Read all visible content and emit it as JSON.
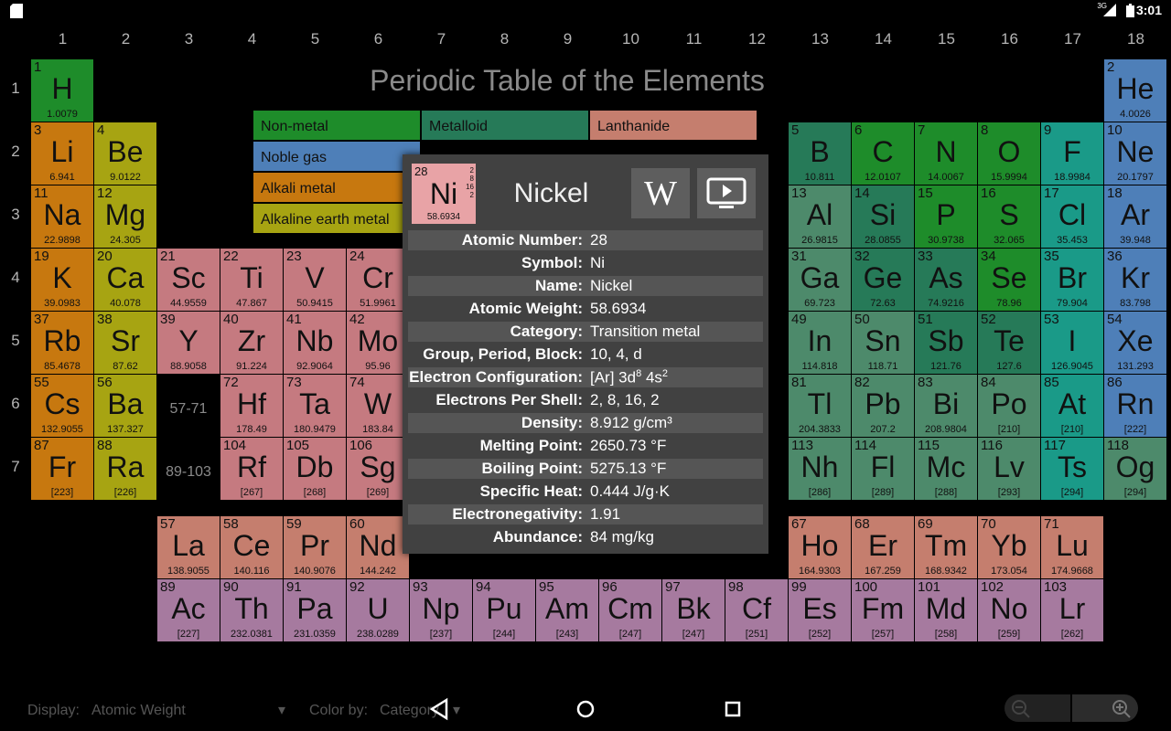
{
  "status_bar": {
    "time": "3:01",
    "signal_label": "3G"
  },
  "title": "Periodic Table of the Elements",
  "group_numbers": [
    "1",
    "2",
    "3",
    "4",
    "5",
    "6",
    "7",
    "8",
    "9",
    "10",
    "11",
    "12",
    "13",
    "14",
    "15",
    "16",
    "17",
    "18"
  ],
  "period_numbers": [
    "1",
    "2",
    "3",
    "4",
    "5",
    "6",
    "7"
  ],
  "colors": {
    "nonmetal": "#1e8c2a",
    "noble_gas": "#4e7fb8",
    "alkali": "#c7780f",
    "alkaline": "#a7a412",
    "metalloid": "#267a58",
    "lanthanide": "#c57e6e",
    "actinide": "#a67a9f",
    "transition": "#c57a80",
    "post_transition": "#4d8a6b",
    "halogen": "#1a9a88",
    "unknown": "#4d8a6b",
    "popup_bg": "#414141",
    "nickel_cell": "#e8a3a6"
  },
  "legend": [
    {
      "label": "Non-metal",
      "color_key": "nonmetal"
    },
    {
      "label": "Metalloid",
      "color_key": "metalloid"
    },
    {
      "label": "Lanthanide",
      "color_key": "lanthanide"
    },
    {
      "label": "Noble gas",
      "color_key": "noble_gas"
    },
    {
      "label": "Alkali metal",
      "color_key": "alkali"
    },
    {
      "label": "Alkaline earth metal",
      "color_key": "alkaline"
    }
  ],
  "range_labels": [
    "57-71",
    "89-103"
  ],
  "elements": [
    {
      "n": "1",
      "s": "H",
      "w": "1.0079",
      "c": "nonmetal",
      "col": 1,
      "row": 1
    },
    {
      "n": "2",
      "s": "He",
      "w": "4.0026",
      "c": "noble_gas",
      "col": 18,
      "row": 1
    },
    {
      "n": "3",
      "s": "Li",
      "w": "6.941",
      "c": "alkali",
      "col": 1,
      "row": 2
    },
    {
      "n": "4",
      "s": "Be",
      "w": "9.0122",
      "c": "alkaline",
      "col": 2,
      "row": 2
    },
    {
      "n": "5",
      "s": "B",
      "w": "10.811",
      "c": "metalloid",
      "col": 13,
      "row": 2
    },
    {
      "n": "6",
      "s": "C",
      "w": "12.0107",
      "c": "nonmetal",
      "col": 14,
      "row": 2
    },
    {
      "n": "7",
      "s": "N",
      "w": "14.0067",
      "c": "nonmetal",
      "col": 15,
      "row": 2
    },
    {
      "n": "8",
      "s": "O",
      "w": "15.9994",
      "c": "nonmetal",
      "col": 16,
      "row": 2
    },
    {
      "n": "9",
      "s": "F",
      "w": "18.9984",
      "c": "halogen",
      "col": 17,
      "row": 2
    },
    {
      "n": "10",
      "s": "Ne",
      "w": "20.1797",
      "c": "noble_gas",
      "col": 18,
      "row": 2
    },
    {
      "n": "11",
      "s": "Na",
      "w": "22.9898",
      "c": "alkali",
      "col": 1,
      "row": 3
    },
    {
      "n": "12",
      "s": "Mg",
      "w": "24.305",
      "c": "alkaline",
      "col": 2,
      "row": 3
    },
    {
      "n": "13",
      "s": "Al",
      "w": "26.9815",
      "c": "post_transition",
      "col": 13,
      "row": 3
    },
    {
      "n": "14",
      "s": "Si",
      "w": "28.0855",
      "c": "metalloid",
      "col": 14,
      "row": 3
    },
    {
      "n": "15",
      "s": "P",
      "w": "30.9738",
      "c": "nonmetal",
      "col": 15,
      "row": 3
    },
    {
      "n": "16",
      "s": "S",
      "w": "32.065",
      "c": "nonmetal",
      "col": 16,
      "row": 3
    },
    {
      "n": "17",
      "s": "Cl",
      "w": "35.453",
      "c": "halogen",
      "col": 17,
      "row": 3
    },
    {
      "n": "18",
      "s": "Ar",
      "w": "39.948",
      "c": "noble_gas",
      "col": 18,
      "row": 3
    },
    {
      "n": "19",
      "s": "K",
      "w": "39.0983",
      "c": "alkali",
      "col": 1,
      "row": 4
    },
    {
      "n": "20",
      "s": "Ca",
      "w": "40.078",
      "c": "alkaline",
      "col": 2,
      "row": 4
    },
    {
      "n": "21",
      "s": "Sc",
      "w": "44.9559",
      "c": "transition",
      "col": 3,
      "row": 4
    },
    {
      "n": "22",
      "s": "Ti",
      "w": "47.867",
      "c": "transition",
      "col": 4,
      "row": 4
    },
    {
      "n": "23",
      "s": "V",
      "w": "50.9415",
      "c": "transition",
      "col": 5,
      "row": 4
    },
    {
      "n": "24",
      "s": "Cr",
      "w": "51.9961",
      "c": "transition",
      "col": 6,
      "row": 4
    },
    {
      "n": "31",
      "s": "Ga",
      "w": "69.723",
      "c": "post_transition",
      "col": 13,
      "row": 4
    },
    {
      "n": "32",
      "s": "Ge",
      "w": "72.63",
      "c": "metalloid",
      "col": 14,
      "row": 4
    },
    {
      "n": "33",
      "s": "As",
      "w": "74.9216",
      "c": "metalloid",
      "col": 15,
      "row": 4
    },
    {
      "n": "34",
      "s": "Se",
      "w": "78.96",
      "c": "nonmetal",
      "col": 16,
      "row": 4
    },
    {
      "n": "35",
      "s": "Br",
      "w": "79.904",
      "c": "halogen",
      "col": 17,
      "row": 4
    },
    {
      "n": "36",
      "s": "Kr",
      "w": "83.798",
      "c": "noble_gas",
      "col": 18,
      "row": 4
    },
    {
      "n": "37",
      "s": "Rb",
      "w": "85.4678",
      "c": "alkali",
      "col": 1,
      "row": 5
    },
    {
      "n": "38",
      "s": "Sr",
      "w": "87.62",
      "c": "alkaline",
      "col": 2,
      "row": 5
    },
    {
      "n": "39",
      "s": "Y",
      "w": "88.9058",
      "c": "transition",
      "col": 3,
      "row": 5
    },
    {
      "n": "40",
      "s": "Zr",
      "w": "91.224",
      "c": "transition",
      "col": 4,
      "row": 5
    },
    {
      "n": "41",
      "s": "Nb",
      "w": "92.9064",
      "c": "transition",
      "col": 5,
      "row": 5
    },
    {
      "n": "42",
      "s": "Mo",
      "w": "95.96",
      "c": "transition",
      "col": 6,
      "row": 5
    },
    {
      "n": "49",
      "s": "In",
      "w": "114.818",
      "c": "post_transition",
      "col": 13,
      "row": 5
    },
    {
      "n": "50",
      "s": "Sn",
      "w": "118.71",
      "c": "post_transition",
      "col": 14,
      "row": 5
    },
    {
      "n": "51",
      "s": "Sb",
      "w": "121.76",
      "c": "metalloid",
      "col": 15,
      "row": 5
    },
    {
      "n": "52",
      "s": "Te",
      "w": "127.6",
      "c": "metalloid",
      "col": 16,
      "row": 5
    },
    {
      "n": "53",
      "s": "I",
      "w": "126.9045",
      "c": "halogen",
      "col": 17,
      "row": 5
    },
    {
      "n": "54",
      "s": "Xe",
      "w": "131.293",
      "c": "noble_gas",
      "col": 18,
      "row": 5
    },
    {
      "n": "55",
      "s": "Cs",
      "w": "132.9055",
      "c": "alkali",
      "col": 1,
      "row": 6
    },
    {
      "n": "56",
      "s": "Ba",
      "w": "137.327",
      "c": "alkaline",
      "col": 2,
      "row": 6
    },
    {
      "n": "72",
      "s": "Hf",
      "w": "178.49",
      "c": "transition",
      "col": 4,
      "row": 6
    },
    {
      "n": "73",
      "s": "Ta",
      "w": "180.9479",
      "c": "transition",
      "col": 5,
      "row": 6
    },
    {
      "n": "74",
      "s": "W",
      "w": "183.84",
      "c": "transition",
      "col": 6,
      "row": 6
    },
    {
      "n": "81",
      "s": "Tl",
      "w": "204.3833",
      "c": "post_transition",
      "col": 13,
      "row": 6
    },
    {
      "n": "82",
      "s": "Pb",
      "w": "207.2",
      "c": "post_transition",
      "col": 14,
      "row": 6
    },
    {
      "n": "83",
      "s": "Bi",
      "w": "208.9804",
      "c": "post_transition",
      "col": 15,
      "row": 6
    },
    {
      "n": "84",
      "s": "Po",
      "w": "[210]",
      "c": "post_transition",
      "col": 16,
      "row": 6
    },
    {
      "n": "85",
      "s": "At",
      "w": "[210]",
      "c": "halogen",
      "col": 17,
      "row": 6
    },
    {
      "n": "86",
      "s": "Rn",
      "w": "[222]",
      "c": "noble_gas",
      "col": 18,
      "row": 6
    },
    {
      "n": "87",
      "s": "Fr",
      "w": "[223]",
      "c": "alkali",
      "col": 1,
      "row": 7
    },
    {
      "n": "88",
      "s": "Ra",
      "w": "[226]",
      "c": "alkaline",
      "col": 2,
      "row": 7
    },
    {
      "n": "104",
      "s": "Rf",
      "w": "[267]",
      "c": "transition",
      "col": 4,
      "row": 7
    },
    {
      "n": "105",
      "s": "Db",
      "w": "[268]",
      "c": "transition",
      "col": 5,
      "row": 7
    },
    {
      "n": "106",
      "s": "Sg",
      "w": "[269]",
      "c": "transition",
      "col": 6,
      "row": 7
    },
    {
      "n": "113",
      "s": "Nh",
      "w": "[286]",
      "c": "unknown",
      "col": 13,
      "row": 7
    },
    {
      "n": "114",
      "s": "Fl",
      "w": "[289]",
      "c": "unknown",
      "col": 14,
      "row": 7
    },
    {
      "n": "115",
      "s": "Mc",
      "w": "[288]",
      "c": "unknown",
      "col": 15,
      "row": 7
    },
    {
      "n": "116",
      "s": "Lv",
      "w": "[293]",
      "c": "unknown",
      "col": 16,
      "row": 7
    },
    {
      "n": "117",
      "s": "Ts",
      "w": "[294]",
      "c": "halogen",
      "col": 17,
      "row": 7
    },
    {
      "n": "118",
      "s": "Og",
      "w": "[294]",
      "c": "unknown",
      "col": 18,
      "row": 7
    },
    {
      "n": "57",
      "s": "La",
      "w": "138.9055",
      "c": "lanthanide",
      "col": 3,
      "row": 8
    },
    {
      "n": "58",
      "s": "Ce",
      "w": "140.116",
      "c": "lanthanide",
      "col": 4,
      "row": 8
    },
    {
      "n": "59",
      "s": "Pr",
      "w": "140.9076",
      "c": "lanthanide",
      "col": 5,
      "row": 8
    },
    {
      "n": "60",
      "s": "Nd",
      "w": "144.242",
      "c": "lanthanide",
      "col": 6,
      "row": 8
    },
    {
      "n": "67",
      "s": "Ho",
      "w": "164.9303",
      "c": "lanthanide",
      "col": 13,
      "row": 8
    },
    {
      "n": "68",
      "s": "Er",
      "w": "167.259",
      "c": "lanthanide",
      "col": 14,
      "row": 8
    },
    {
      "n": "69",
      "s": "Tm",
      "w": "168.9342",
      "c": "lanthanide",
      "col": 15,
      "row": 8
    },
    {
      "n": "70",
      "s": "Yb",
      "w": "173.054",
      "c": "lanthanide",
      "col": 16,
      "row": 8
    },
    {
      "n": "71",
      "s": "Lu",
      "w": "174.9668",
      "c": "lanthanide",
      "col": 17,
      "row": 8
    },
    {
      "n": "89",
      "s": "Ac",
      "w": "[227]",
      "c": "actinide",
      "col": 3,
      "row": 9
    },
    {
      "n": "90",
      "s": "Th",
      "w": "232.0381",
      "c": "actinide",
      "col": 4,
      "row": 9
    },
    {
      "n": "91",
      "s": "Pa",
      "w": "231.0359",
      "c": "actinide",
      "col": 5,
      "row": 9
    },
    {
      "n": "92",
      "s": "U",
      "w": "238.0289",
      "c": "actinide",
      "col": 6,
      "row": 9
    },
    {
      "n": "93",
      "s": "Np",
      "w": "[237]",
      "c": "actinide",
      "col": 7,
      "row": 9
    },
    {
      "n": "94",
      "s": "Pu",
      "w": "[244]",
      "c": "actinide",
      "col": 8,
      "row": 9
    },
    {
      "n": "95",
      "s": "Am",
      "w": "[243]",
      "c": "actinide",
      "col": 9,
      "row": 9
    },
    {
      "n": "96",
      "s": "Cm",
      "w": "[247]",
      "c": "actinide",
      "col": 10,
      "row": 9
    },
    {
      "n": "97",
      "s": "Bk",
      "w": "[247]",
      "c": "actinide",
      "col": 11,
      "row": 9
    },
    {
      "n": "98",
      "s": "Cf",
      "w": "[251]",
      "c": "actinide",
      "col": 12,
      "row": 9
    },
    {
      "n": "99",
      "s": "Es",
      "w": "[252]",
      "c": "actinide",
      "col": 13,
      "row": 9
    },
    {
      "n": "100",
      "s": "Fm",
      "w": "[257]",
      "c": "actinide",
      "col": 14,
      "row": 9
    },
    {
      "n": "101",
      "s": "Md",
      "w": "[258]",
      "c": "actinide",
      "col": 15,
      "row": 9
    },
    {
      "n": "102",
      "s": "No",
      "w": "[259]",
      "c": "actinide",
      "col": 16,
      "row": 9
    },
    {
      "n": "103",
      "s": "Lr",
      "w": "[262]",
      "c": "actinide",
      "col": 17,
      "row": 9
    }
  ],
  "popup": {
    "number": "28",
    "symbol": "Ni",
    "weight": "58.6934",
    "shells": [
      "2",
      "8",
      "16",
      "2"
    ],
    "name": "Nickel",
    "wiki_label": "W",
    "rows": [
      {
        "k": "Atomic Number:",
        "v": "28"
      },
      {
        "k": "Symbol:",
        "v": "Ni"
      },
      {
        "k": "Name:",
        "v": "Nickel"
      },
      {
        "k": "Atomic Weight:",
        "v": "58.6934"
      },
      {
        "k": "Category:",
        "v": "Transition metal"
      },
      {
        "k": "Group, Period, Block:",
        "v": "10, 4, d"
      },
      {
        "k": "Electron Configuration:",
        "v": "[Ar] 3d8 4s2",
        "v_parts": [
          "[Ar] 3d",
          "8",
          " 4s",
          "2"
        ]
      },
      {
        "k": "Electrons Per Shell:",
        "v": "2, 8, 16, 2"
      },
      {
        "k": "Density:",
        "v": "8.912 g/cm³"
      },
      {
        "k": "Melting Point:",
        "v": "2650.73 °F"
      },
      {
        "k": "Boiling Point:",
        "v": "5275.13 °F"
      },
      {
        "k": "Specific Heat:",
        "v": "0.444 J/g·K"
      },
      {
        "k": "Electronegativity:",
        "v": "1.91"
      },
      {
        "k": "Abundance:",
        "v": "84 mg/kg"
      }
    ]
  },
  "bottom": {
    "display_label": "Display:",
    "display_value": "Atomic Weight",
    "color_label": "Color by:",
    "color_value": "Category"
  }
}
